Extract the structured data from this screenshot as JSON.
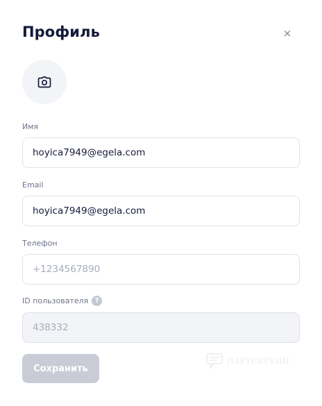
{
  "dialog": {
    "title": "Профиль",
    "close_symbol": "×"
  },
  "avatar": {
    "icon": "camera-icon"
  },
  "fields": {
    "name": {
      "label": "Имя",
      "value": "hoyica7949@egela.com"
    },
    "email": {
      "label": "Email",
      "value": "hoyica7949@egela.com"
    },
    "phone": {
      "label": "Телефон",
      "value": "",
      "placeholder": "+1234567890"
    },
    "user_id": {
      "label": "ID пользователя",
      "value": "438332",
      "help_symbol": "?"
    }
  },
  "actions": {
    "save_label": "Сохранить"
  },
  "watermark": {
    "text": "ПАРТНЕРКИН",
    "icon": "chat-bubble-icon"
  },
  "colors": {
    "title": "#141a3a",
    "save_button_disabled": "#c9ccd6",
    "input_border": "#dfe2ea",
    "disabled_background": "#f3f4f7"
  }
}
